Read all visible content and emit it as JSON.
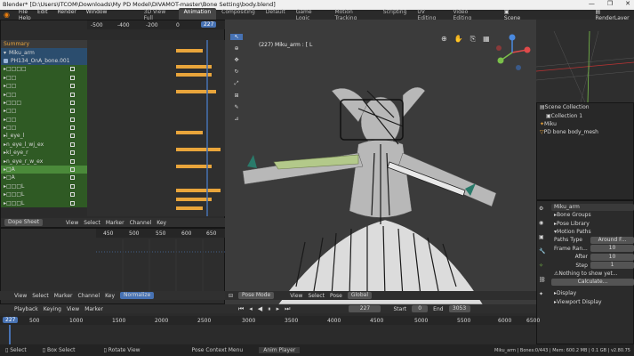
{
  "window": {
    "title": "Blender* [D:\\Users\\ITCOM\\Downloads\\My PD Model\\DIVAMOT-master\\Bone Setting\\body.blend]",
    "minimize": "—",
    "maximize": "❐",
    "close": "✕"
  },
  "menu": [
    "File",
    "Edit",
    "Render",
    "Window",
    "Help"
  ],
  "workspaces": [
    "3D View Full",
    "Animation",
    "Compositing",
    "Default",
    "Game Logic",
    "Motion Tracking",
    "Scripting",
    "UV Editing",
    "Video Editing"
  ],
  "active_workspace": "Animation",
  "scene": {
    "label": "Scene",
    "render_layer": "RenderLayer"
  },
  "dopesheet": {
    "ruler": [
      "-500",
      "-400",
      "-200",
      "0",
      "227"
    ],
    "rows": [
      "Summary",
      "Miku_arm",
      "PH134_OnA_bone.001",
      "□□□□",
      "□□",
      "□□",
      "□□",
      "□□□",
      "□□",
      "□□",
      "□□",
      "l_eye_l",
      "n_eye_l_wj_ex",
      "kl_eye_r",
      "n_eye_r_w_ex",
      "□A",
      "□A",
      "□□□L",
      "□□□L",
      "□□□L"
    ],
    "mode": "Dope Sheet",
    "header": [
      "View",
      "Select",
      "Marker",
      "Channel",
      "Key"
    ]
  },
  "graph": {
    "ruler": [
      "450",
      "500",
      "550",
      "600",
      "650"
    ]
  },
  "graph_header": [
    "View",
    "Select",
    "Marker",
    "Channel",
    "Key",
    "Normalize"
  ],
  "viewport": {
    "info": "(227) Miku_arm : [ L",
    "mode": "Pose Mode",
    "header": [
      "View",
      "Select",
      "Pose"
    ],
    "orient": "Global"
  },
  "timeline": {
    "header": [
      "Playback",
      "Keying",
      "View",
      "Marker"
    ],
    "current_frame": "227",
    "ruler": [
      "227",
      "500",
      "1000",
      "1500",
      "2000",
      "2500",
      "3000",
      "3500",
      "4000",
      "4500",
      "5000",
      "5500",
      "6000",
      "6500"
    ],
    "frame": "227",
    "start_label": "Start",
    "start": "0",
    "end_label": "End",
    "end": "3053"
  },
  "outliner": {
    "root": "Scene Collection",
    "collection": "Collection 1",
    "items": [
      "Miku",
      "PD bone body_mesh"
    ]
  },
  "properties": {
    "object": "Miku_arm",
    "sections": [
      "Bone Groups",
      "Pose Library",
      "Motion Paths"
    ],
    "paths_type_label": "Paths Type",
    "paths_type": "Around F...",
    "frame_range_label": "Frame Ran...",
    "frame_range": "10",
    "after_label": "After",
    "after": "10",
    "step_label": "Step",
    "step": "1",
    "warning": "Nothing to show yet...",
    "calculate": "Calculate...",
    "display": "Display",
    "viewport_display": "Viewport Display"
  },
  "status": {
    "items": [
      "Select",
      "Box Select",
      "Rotate View",
      "Pose Context Menu",
      "Anim Player"
    ],
    "right": "Miku_arm | Bones:0/443 | Mem: 600.2 MB | 0.1 GB | v2.80.75"
  }
}
